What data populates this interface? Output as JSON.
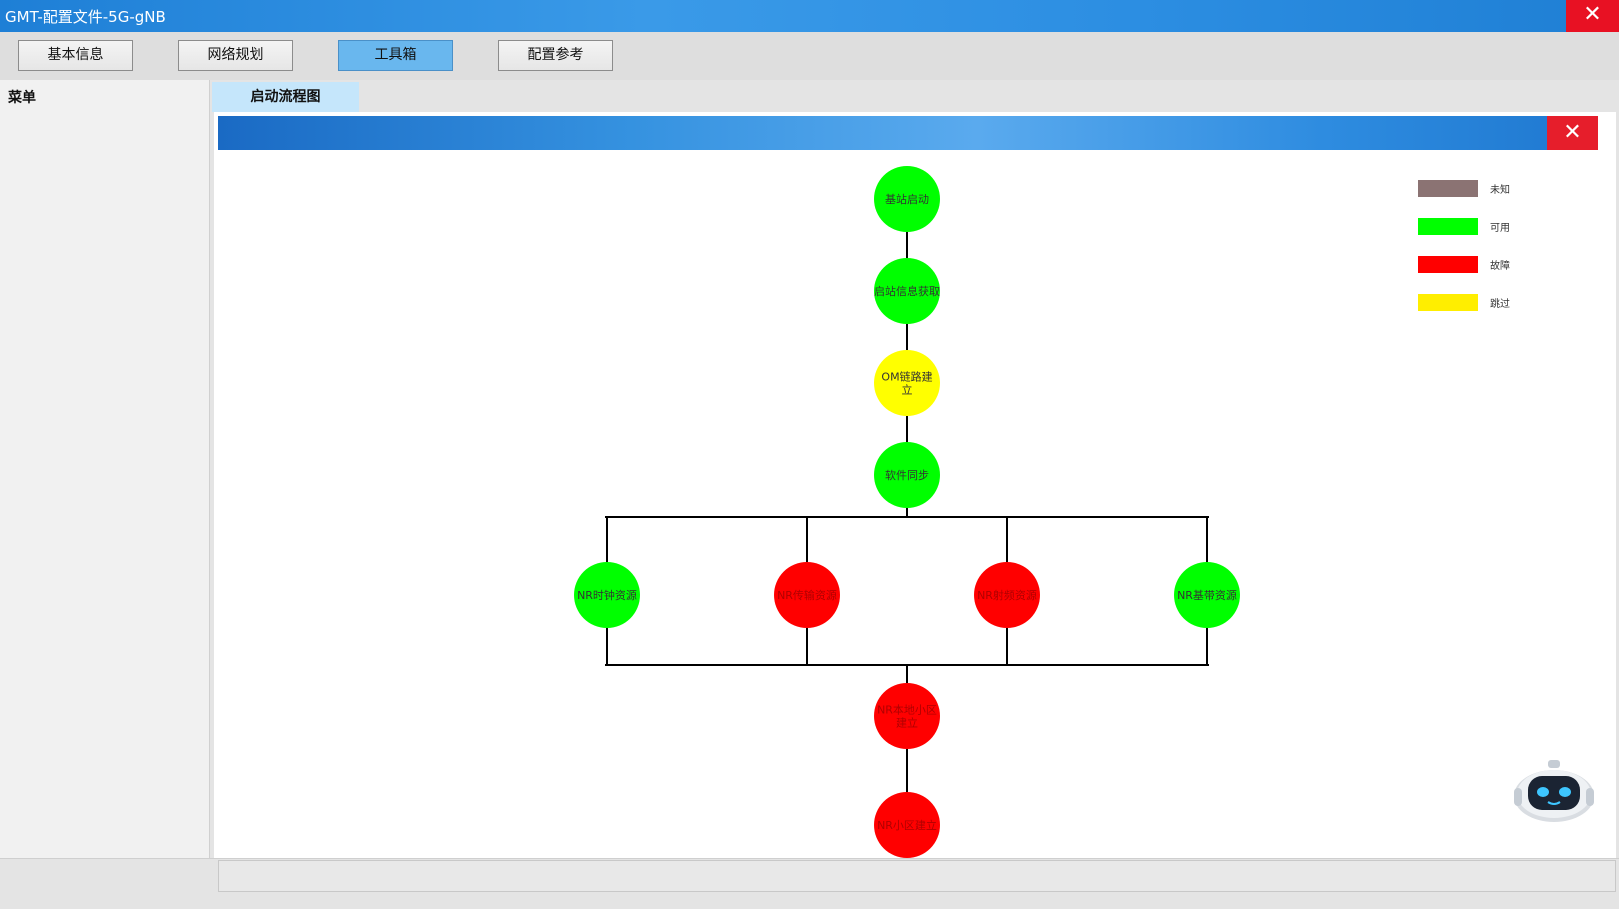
{
  "window": {
    "title": "GMT-配置文件-5G-gNB",
    "close_glyph": "✕"
  },
  "nav": {
    "buttons": [
      "基本信息",
      "网络规划",
      "工具箱",
      "配置参考"
    ],
    "active": "工具箱"
  },
  "sidebar": {
    "title": "菜单"
  },
  "tab": {
    "label": "启动流程图"
  },
  "panel": {
    "close_glyph": "✕"
  },
  "colors": {
    "green": "#00ff00",
    "red": "#ff0000",
    "yellow": "#ffff00",
    "unknown": "#8b7373",
    "accent": "#69b7ee"
  },
  "legend": [
    {
      "label": "未知",
      "color": "#8b7373"
    },
    {
      "label": "可用",
      "color": "#00ff00"
    },
    {
      "label": "故障",
      "color": "#ff0000"
    },
    {
      "label": "跳过",
      "color": "#ffee00"
    }
  ],
  "flow": {
    "nodes": [
      {
        "id": "n1",
        "lines": [
          "基站启动"
        ],
        "status": "可用"
      },
      {
        "id": "n2",
        "lines": [
          "启站信息获取"
        ],
        "status": "可用"
      },
      {
        "id": "n3",
        "lines": [
          "OM链路建",
          "立"
        ],
        "status": "跳过"
      },
      {
        "id": "n4",
        "lines": [
          "软件同步"
        ],
        "status": "可用"
      },
      {
        "id": "n5",
        "lines": [
          "NR时钟资源"
        ],
        "status": "可用"
      },
      {
        "id": "n6",
        "lines": [
          "NR传输资源"
        ],
        "status": "故障"
      },
      {
        "id": "n7",
        "lines": [
          "NR射频资源"
        ],
        "status": "故障"
      },
      {
        "id": "n8",
        "lines": [
          "NR基带资源"
        ],
        "status": "可用"
      },
      {
        "id": "n9",
        "lines": [
          "NR本地小区",
          "建立"
        ],
        "status": "故障"
      },
      {
        "id": "n10",
        "lines": [
          "NR小区建立"
        ],
        "status": "故障"
      }
    ]
  },
  "assistant": {
    "icon": "robot-icon"
  }
}
